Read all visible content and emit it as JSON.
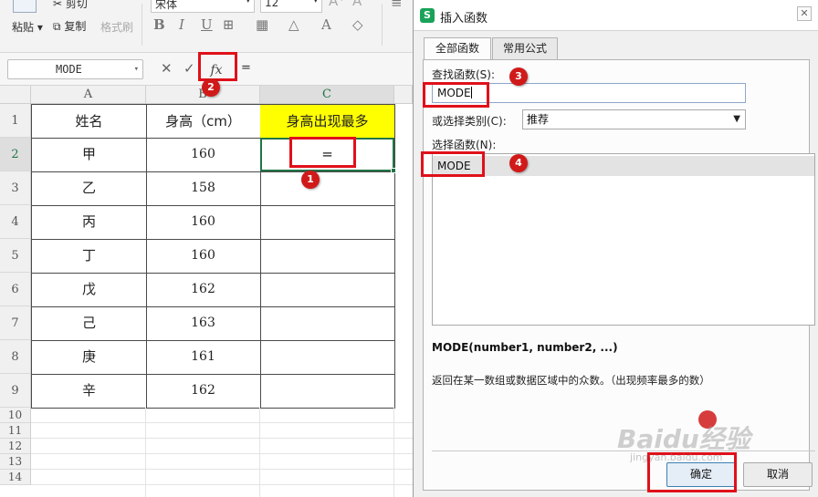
{
  "ribbon": {
    "paste_label": "粘贴",
    "cut_label": "剪切",
    "copy_label": "复制",
    "format_painter_label": "格式刷",
    "font_name": "宋体",
    "font_size": "12"
  },
  "formula_bar": {
    "name_box": "MODE",
    "fx_label": "fx",
    "formula_value": "="
  },
  "sheet": {
    "columns": [
      "A",
      "B",
      "C"
    ],
    "row_numbers": [
      "1",
      "2",
      "3",
      "4",
      "5",
      "6",
      "7",
      "8",
      "9",
      "10",
      "11",
      "12",
      "13",
      "14"
    ],
    "headers": [
      "姓名",
      "身高（cm）",
      "身高出现最多"
    ],
    "rows": [
      {
        "name": "甲",
        "height": "160",
        "c": "="
      },
      {
        "name": "乙",
        "height": "158",
        "c": ""
      },
      {
        "name": "丙",
        "height": "160",
        "c": ""
      },
      {
        "name": "丁",
        "height": "160",
        "c": ""
      },
      {
        "name": "戊",
        "height": "162",
        "c": ""
      },
      {
        "name": "己",
        "height": "163",
        "c": ""
      },
      {
        "name": "庚",
        "height": "161",
        "c": ""
      },
      {
        "name": "辛",
        "height": "162",
        "c": ""
      }
    ],
    "header_fill_color": "#ffff00",
    "active_cell_color": "#217346"
  },
  "dialog": {
    "app_icon": "S",
    "title": "插入函数",
    "tabs": [
      {
        "label": "全部函数",
        "active": true
      },
      {
        "label": "常用公式",
        "active": false
      }
    ],
    "search_label": "查找函数(S):",
    "search_value": "MODE",
    "category_label": "或选择类别(C):",
    "category_value": "推荐",
    "function_list_label": "选择函数(N):",
    "functions": [
      "MODE"
    ],
    "syntax": "MODE(number1, number2, ...)",
    "description": "返回在某一数组或数据区域中的众数。（出现频率最多的数）",
    "ok_label": "确定",
    "cancel_label": "取消"
  },
  "annotations": {
    "step_badges": [
      "1",
      "2",
      "3",
      "4"
    ],
    "highlight_color": "#e0101a",
    "watermark": "Baidu经验",
    "watermark_sub": "jingyan.baidu.com"
  }
}
